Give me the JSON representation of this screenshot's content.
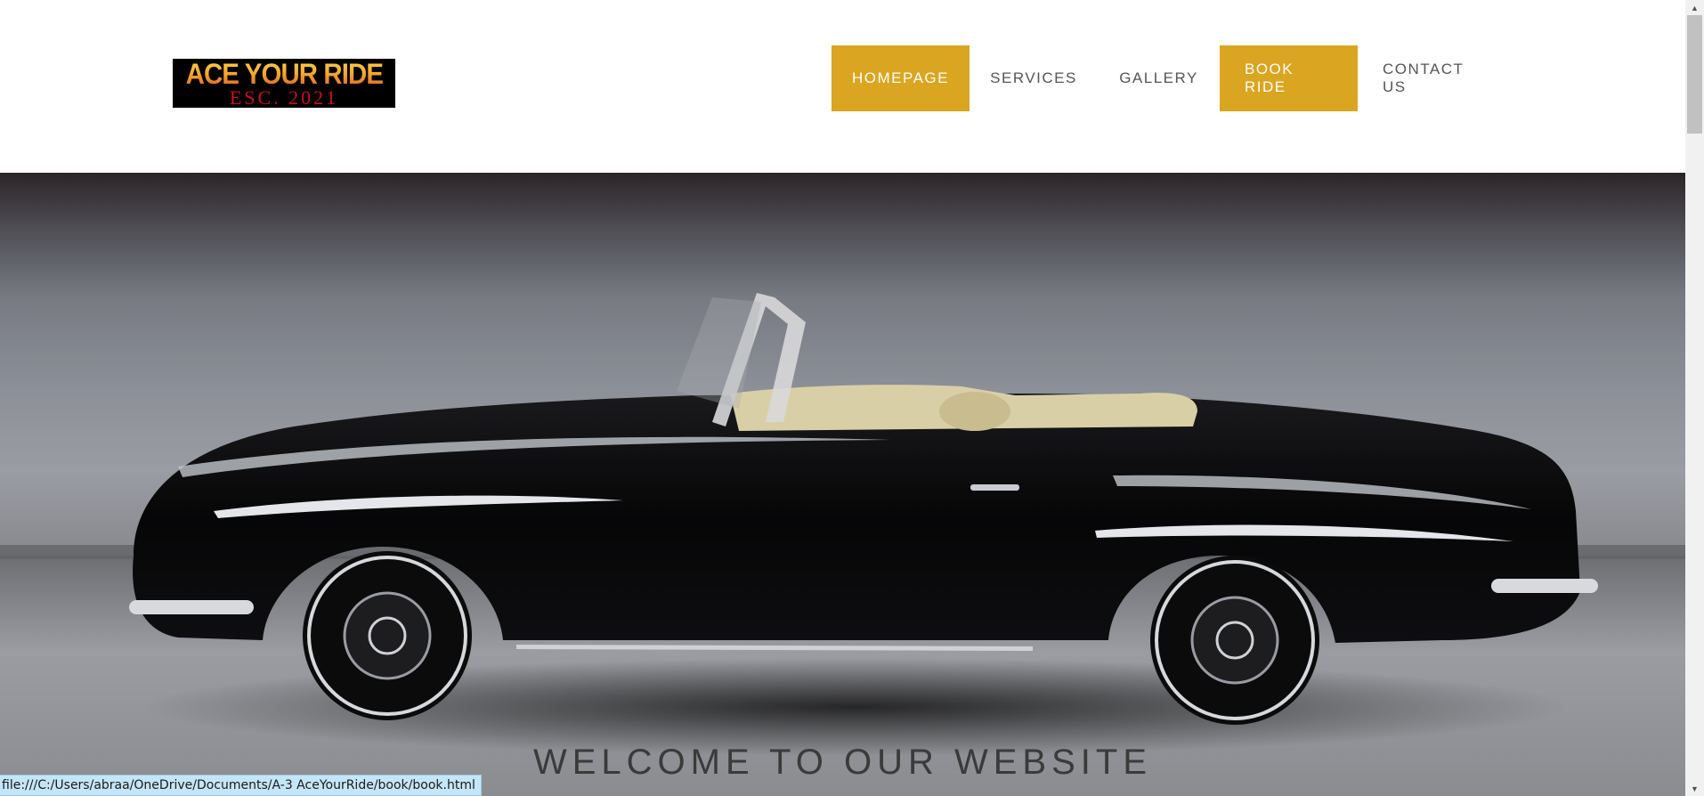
{
  "logo": {
    "title": "ACE YOUR RIDE",
    "subtitle": "ESC. 2021"
  },
  "nav": {
    "items": [
      {
        "label": "HOMEPAGE",
        "active": true
      },
      {
        "label": "SERVICES",
        "active": false
      },
      {
        "label": "GALLERY",
        "active": false
      },
      {
        "label": "BOOK RIDE",
        "active": true
      },
      {
        "label": "CONTACT US",
        "active": false
      }
    ]
  },
  "hero": {
    "welcome_text": "WELCOME TO OUR WEBSITE",
    "image": "black-vintage-convertible-car"
  },
  "statusbar": {
    "url": "file:///C:/Users/abraa/OneDrive/Documents/A-3 AceYourRide/book/book.html"
  },
  "colors": {
    "accent": "#daa520",
    "nav_text": "#555555",
    "status_bg": "#c4e6f8"
  }
}
